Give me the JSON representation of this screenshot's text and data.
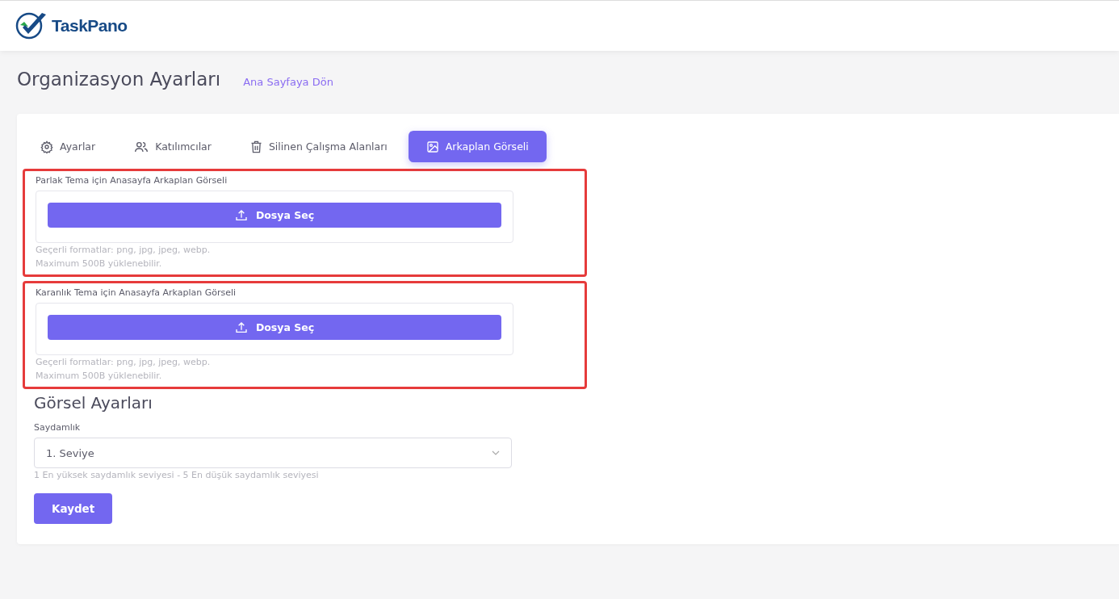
{
  "header": {
    "logo": "TaskPano"
  },
  "page": {
    "title": "Organizasyon Ayarları",
    "back_link": "Ana Sayfaya Dön"
  },
  "tabs": [
    {
      "label": "Ayarlar",
      "kind": "gear",
      "selected": false
    },
    {
      "label": "Katılımcılar",
      "kind": "users",
      "selected": false
    },
    {
      "label": "Silinen Çalışma Alanları",
      "kind": "trash",
      "selected": false
    },
    {
      "label": "Arkaplan Görseli",
      "kind": "image",
      "selected": true
    }
  ],
  "uploads": [
    {
      "label": "Parlak Tema için Anasayfa Arkaplan Görseli",
      "button": "Dosya Seç",
      "hint_1": "Geçerli formatlar: png, jpg, jpeg, webp.",
      "hint_2": "Maximum 500B yüklenebilir.",
      "highlighted": true
    },
    {
      "label": "Karanlık Tema için Anasayfa Arkaplan Görseli",
      "button": "Dosya Seç",
      "hint_1": "Geçerli formatlar: png, jpg, jpeg, webp.",
      "hint_2": "Maximum 500B yüklenebilir.",
      "highlighted": true
    }
  ],
  "settings": {
    "title": "Görsel Ayarları",
    "field_label": "Saydamlık",
    "value": "1. Seviye",
    "help": "1 En yüksek saydamlık seviyesi - 5 En düşük saydamlık seviyesi",
    "save_button": "Kaydet"
  }
}
